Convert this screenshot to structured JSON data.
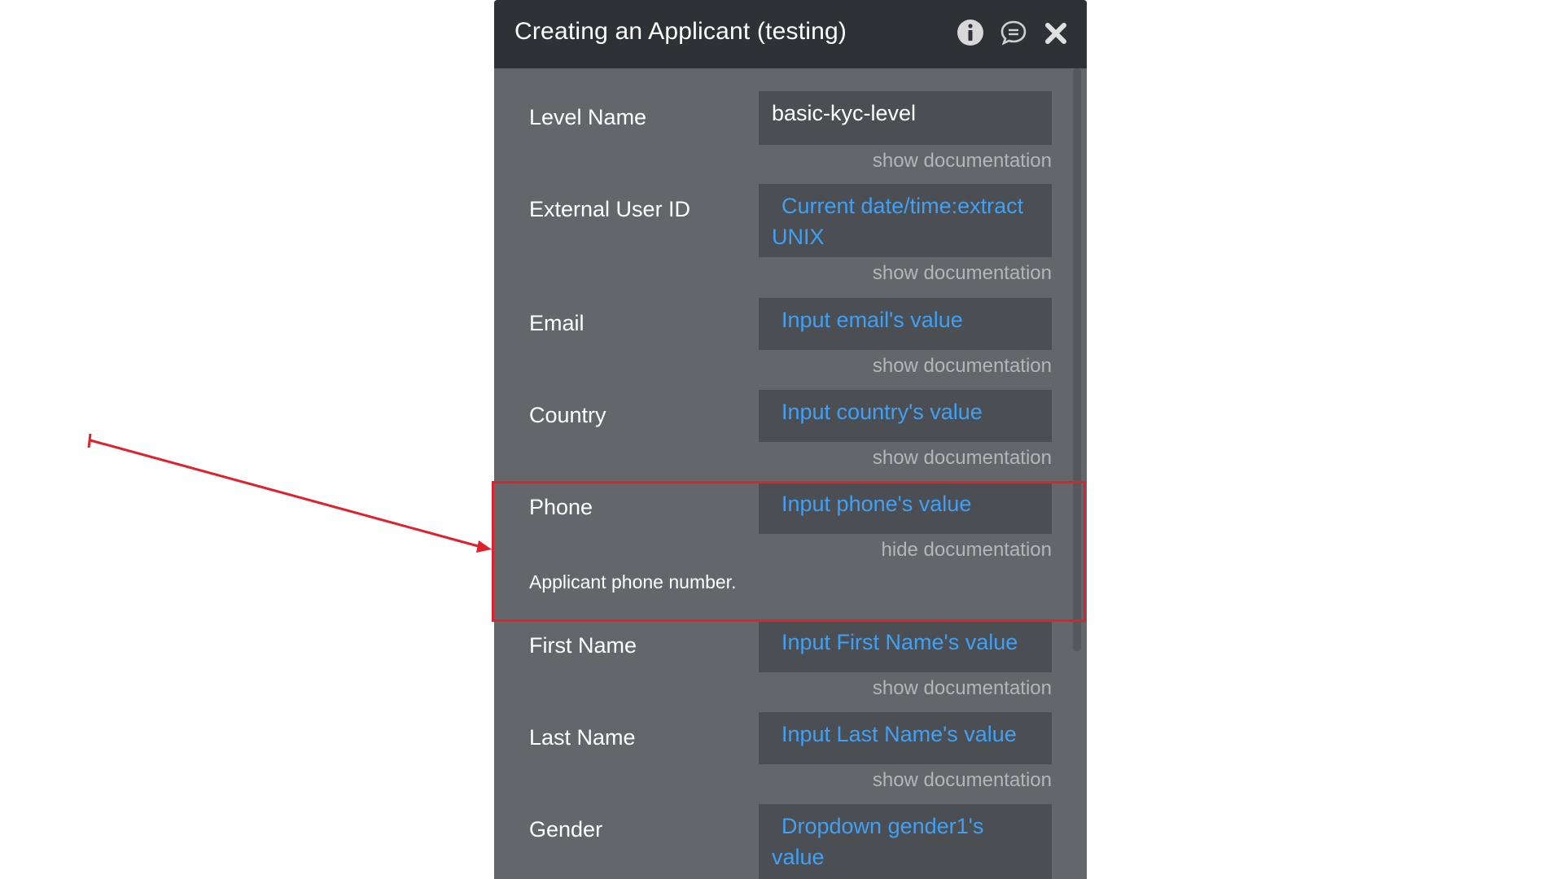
{
  "dialog": {
    "title": "Creating an Applicant (testing)",
    "icons": [
      "info-icon",
      "comment-icon",
      "close-icon"
    ]
  },
  "fields": [
    {
      "label": "Level Name",
      "value": "basic-kyc-level",
      "doc_link": "show documentation"
    },
    {
      "label": "External User ID",
      "value_line1": "Current date/time:extract",
      "value_line2": "UNIX",
      "doc_link": "show documentation"
    },
    {
      "label": "Email",
      "value": "Input email's value",
      "doc_link": "show documentation"
    },
    {
      "label": "Country",
      "value": "Input country's value",
      "doc_link": "show documentation"
    },
    {
      "label": "Phone",
      "value": "Input phone's value",
      "doc_link": "hide documentation",
      "doc_text": "Applicant phone number."
    },
    {
      "label": "First Name",
      "value": "Input First Name's value",
      "doc_link": "show documentation"
    },
    {
      "label": "Last Name",
      "value": "Input Last Name's value",
      "doc_link": "show documentation"
    },
    {
      "label": "Gender",
      "value_line1": "Dropdown gender1's",
      "value_line2": "value"
    }
  ],
  "colors": {
    "panel_bg": "#63676b",
    "header_bg": "#2e3236",
    "dynamic_value": "#3fa0f5",
    "highlight": "#e0202a"
  }
}
